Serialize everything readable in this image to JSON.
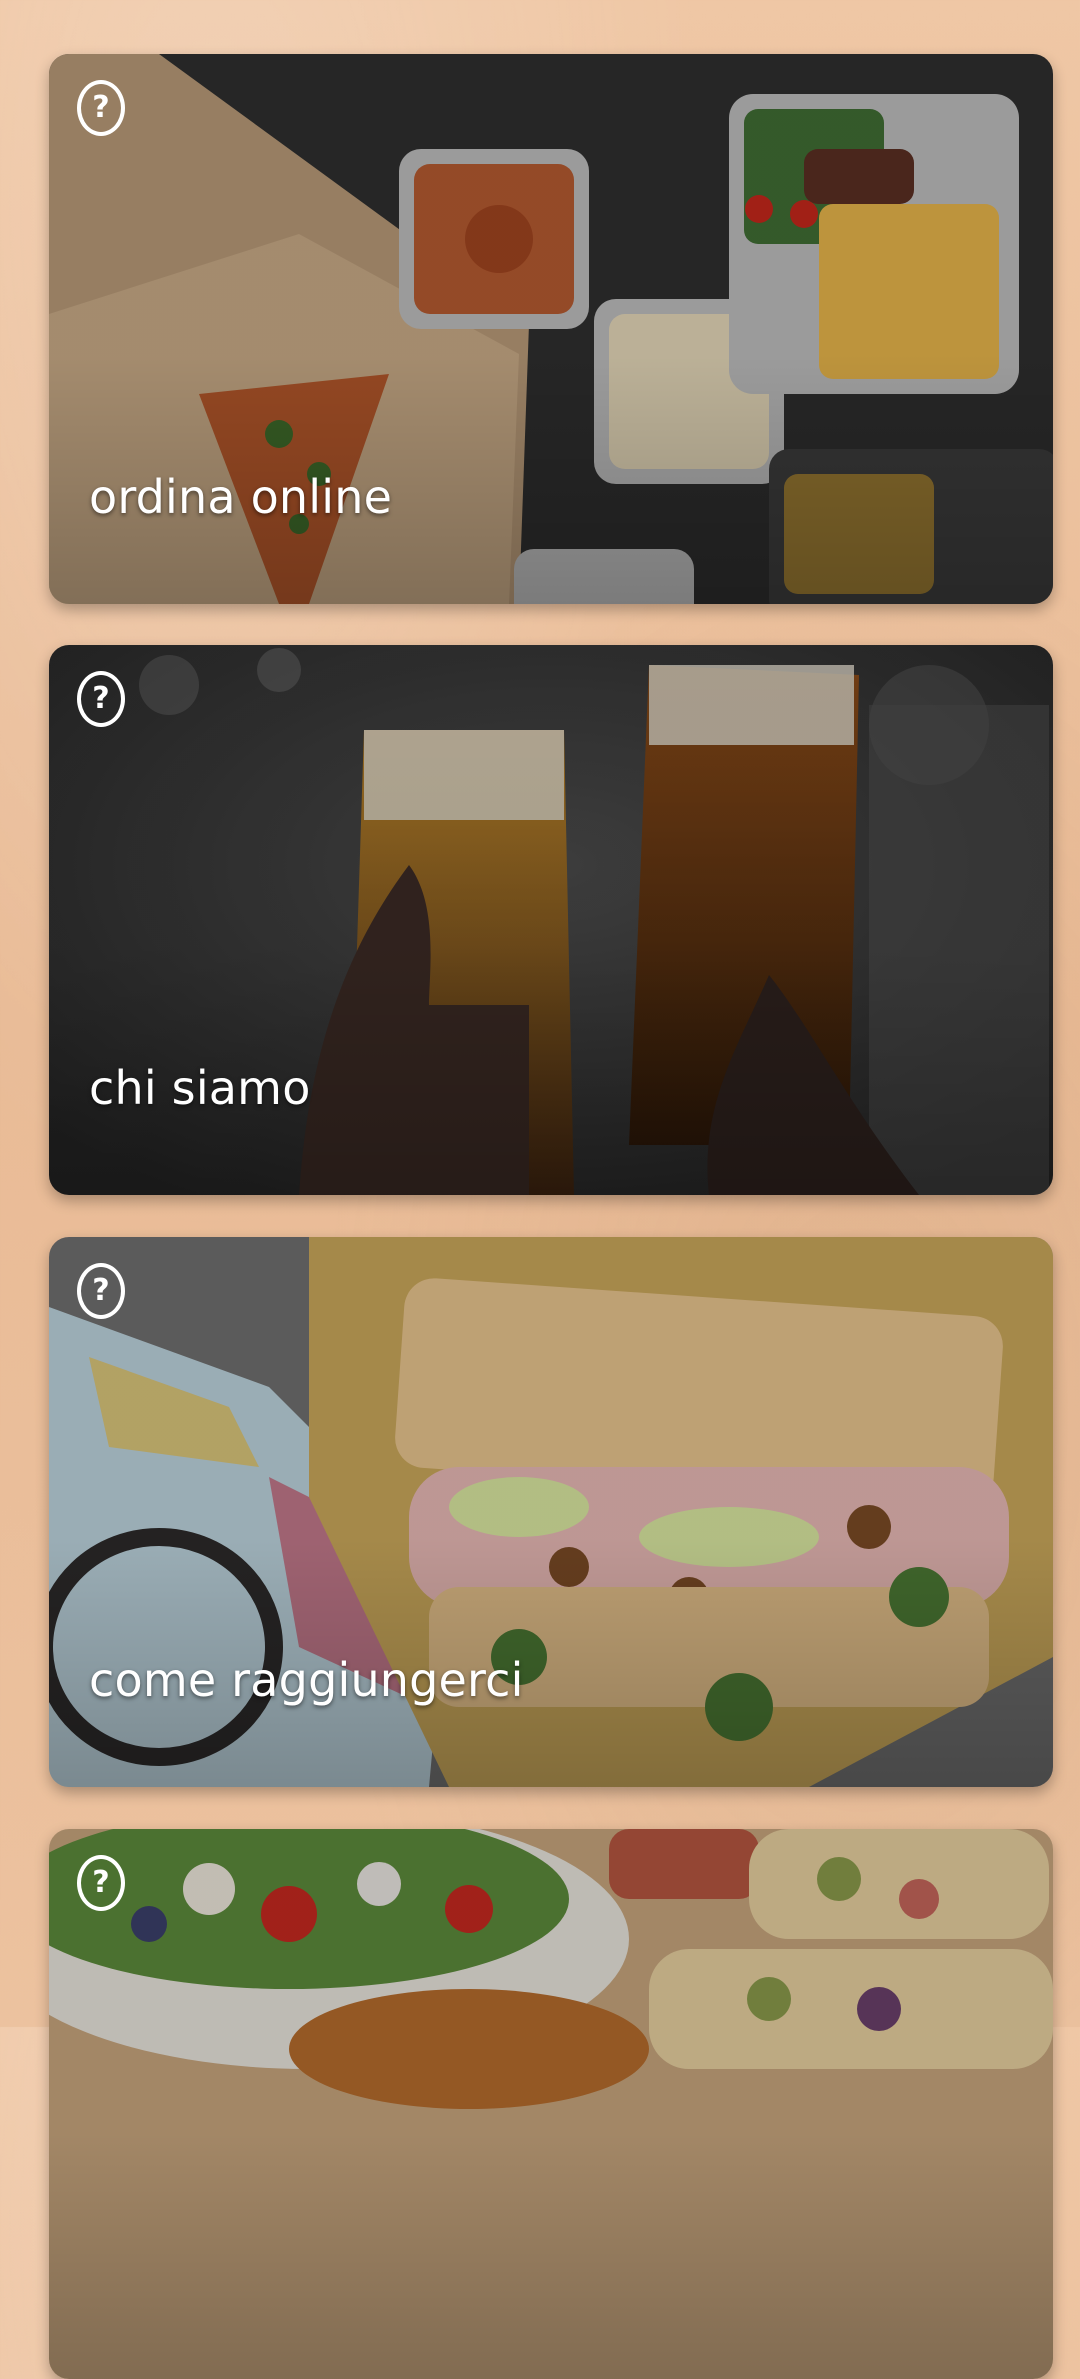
{
  "cards": [
    {
      "title": "ordina online",
      "help_label": "?"
    },
    {
      "title": "chi siamo",
      "help_label": "?"
    },
    {
      "title": "come raggiungerci",
      "help_label": "?"
    },
    {
      "title": "",
      "help_label": "?"
    }
  ],
  "colors": {
    "background": "#ecc29f",
    "title_text": "#ffffff",
    "help_icon": "#ffffff"
  }
}
